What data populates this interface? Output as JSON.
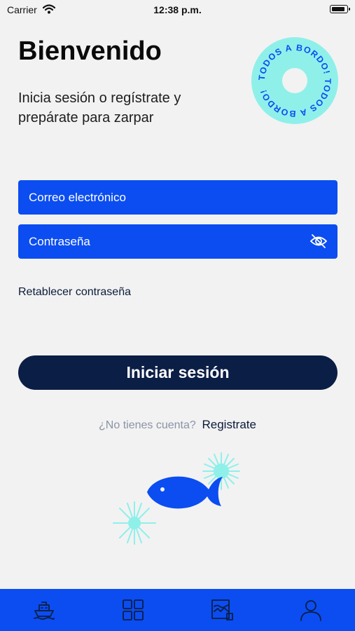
{
  "status_bar": {
    "carrier": "Carrier",
    "time": "12:38 p.m.",
    "battery_level": 1.0
  },
  "header": {
    "title": "Bienvenido",
    "subtitle": "Inicia sesión o regístrate y prepárate para zarpar",
    "badge_text": "TODOS A BORDO! TODOS A BORDO!"
  },
  "form": {
    "email_placeholder": "Correo electrónico",
    "password_placeholder": "Contraseña",
    "reset_label": "Retablecer contraseña",
    "login_label": "Iniciar sesión"
  },
  "signup": {
    "question": "¿No tienes cuenta?",
    "link_label": "Registrate"
  },
  "tab_bar": {
    "items": [
      {
        "icon": "ship-icon"
      },
      {
        "icon": "grid-icon"
      },
      {
        "icon": "map-icon"
      },
      {
        "icon": "profile-icon"
      }
    ]
  },
  "colors": {
    "background": "#f2f2f2",
    "accent_blue": "#0b4df0",
    "navy": "#0b1e45",
    "badge_cyan": "#8ff0ea"
  }
}
